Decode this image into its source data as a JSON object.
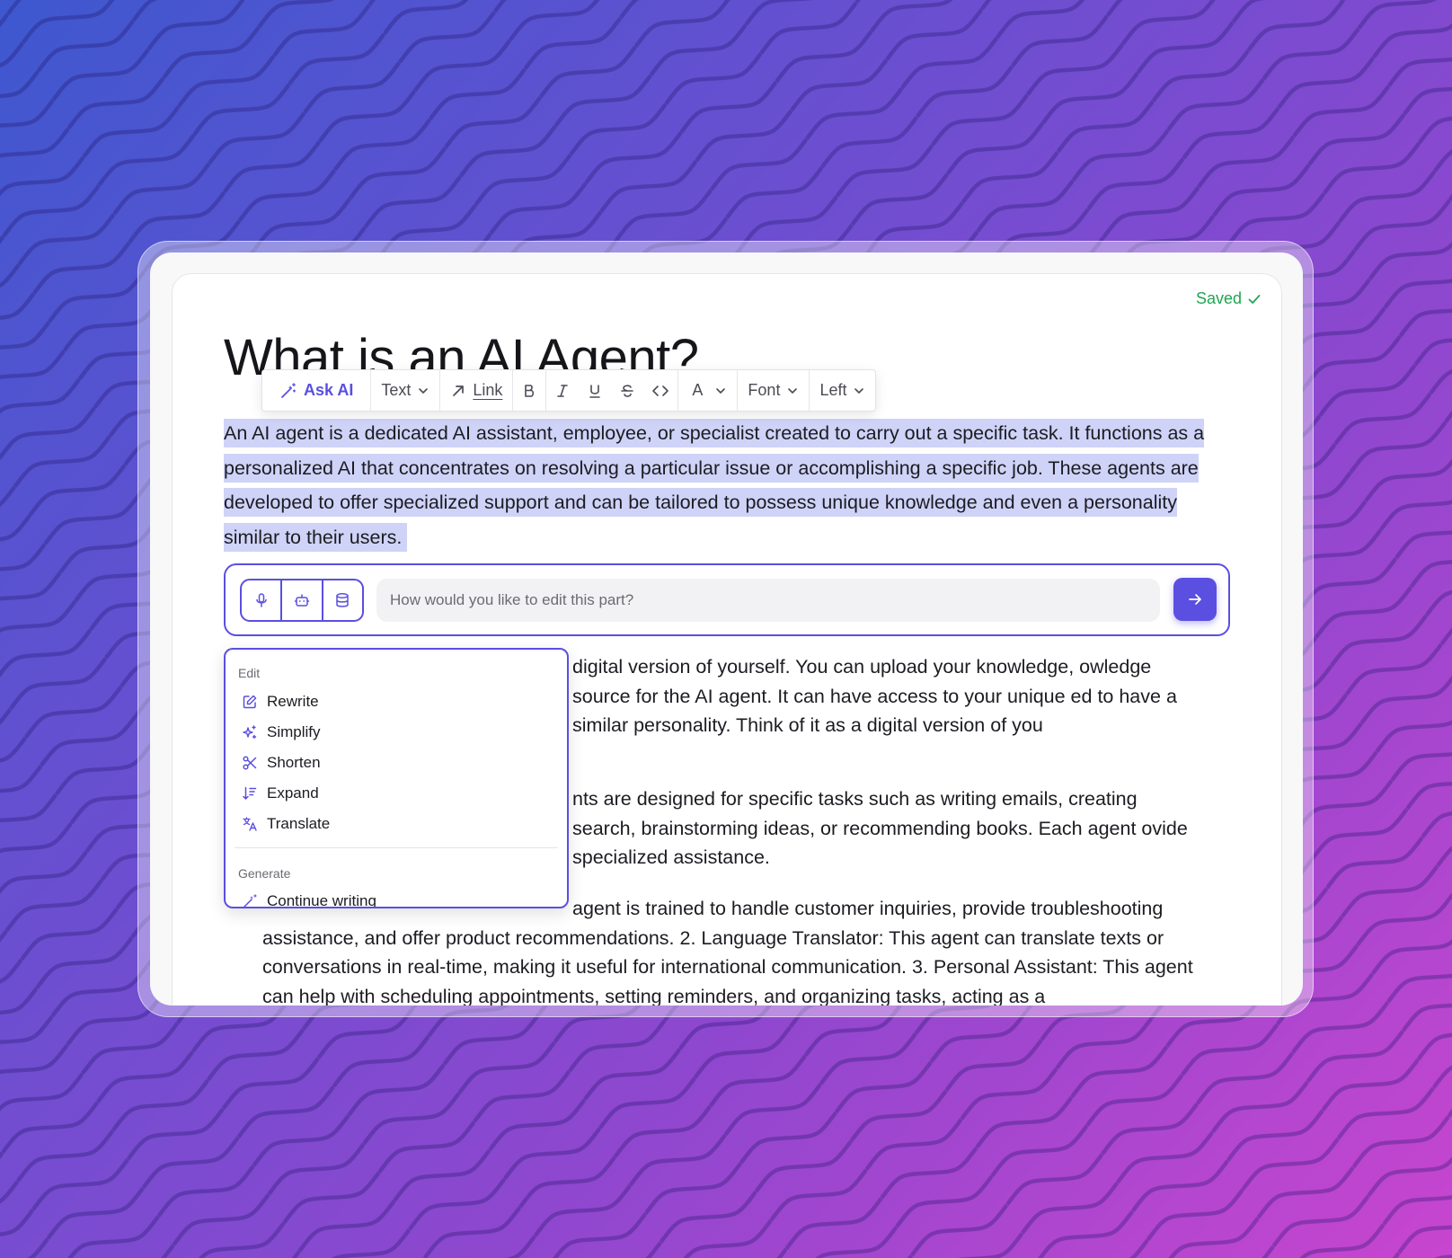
{
  "status": {
    "saved_label": "Saved"
  },
  "document": {
    "title": "What is an AI Agent?",
    "selected_paragraph": "An AI agent is a dedicated AI assistant, employee, or specialist created to carry out a specific task. It functions as a personalized AI that concentrates on resolving a particular issue or accomplishing a specific job. These agents are developed to offer specialized support and can be tailored to possess unique knowledge and even a personality similar to their users.",
    "paragraphs": [
      "digital version of yourself. You can upload your knowledge, owledge source for the AI agent. It can have access to your unique ed to have a similar personality. Think of it as a digital version of you",
      "nts are designed for specific tasks such as writing emails, creating search, brainstorming ideas, or recommending books. Each agent ovide specialized assistance.",
      "agent is trained to handle customer inquiries, provide troubleshooting assistance, and offer product recommendations. 2. Language Translator: This agent can translate texts or conversations in real-time, making it useful for international communication. 3. Personal Assistant: This agent can help with scheduling appointments, setting reminders, and organizing tasks, acting as a"
    ]
  },
  "toolbar": {
    "ask_ai": "Ask AI",
    "text_style": "Text",
    "link": "Link",
    "color": "A",
    "font": "Font",
    "align": "Left",
    "icons": [
      "bold-icon",
      "italic-icon",
      "underline-icon",
      "strikethrough-icon",
      "code-icon"
    ]
  },
  "prompt": {
    "placeholder": "How would you like to edit this part?",
    "buttons": [
      "microphone-icon",
      "bot-icon",
      "database-icon"
    ],
    "send_icon": "arrow-right-icon"
  },
  "menu": {
    "edit_heading": "Edit",
    "edit_items": [
      {
        "label": "Rewrite",
        "icon": "pencil-square-icon"
      },
      {
        "label": "Simplify",
        "icon": "sparkles-icon"
      },
      {
        "label": "Shorten",
        "icon": "scissors-icon"
      },
      {
        "label": "Expand",
        "icon": "expand-list-icon"
      },
      {
        "label": "Translate",
        "icon": "translate-icon"
      }
    ],
    "generate_heading": "Generate",
    "generate_items": [
      {
        "label": "Continue writing",
        "icon": "wand-icon"
      }
    ]
  },
  "colors": {
    "accent": "#5a4fe0",
    "saved": "#1fa652",
    "selection": "#cfd3f7"
  }
}
